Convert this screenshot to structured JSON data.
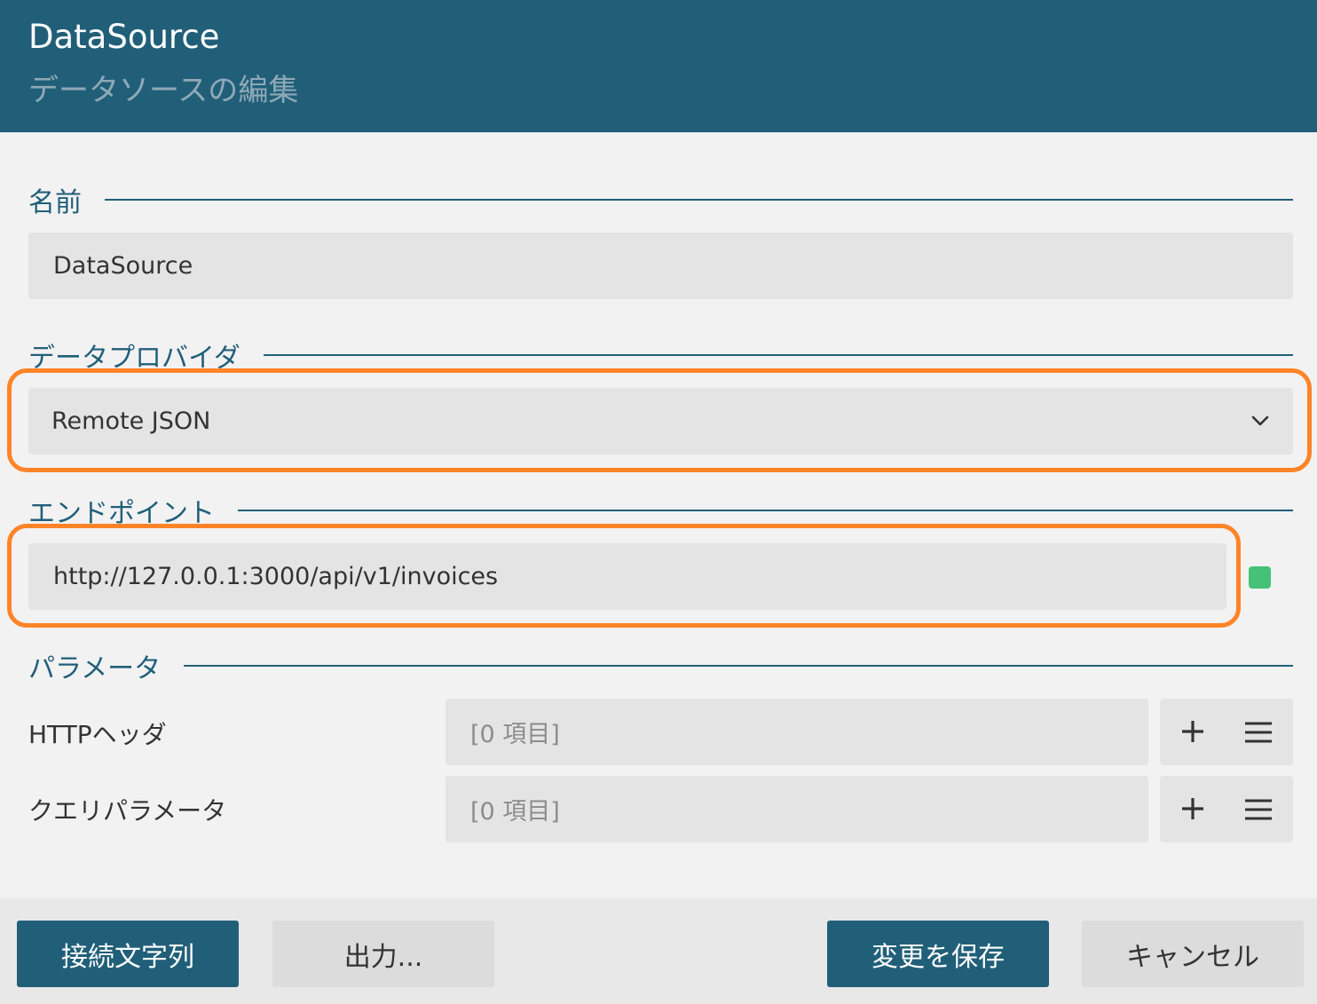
{
  "header": {
    "title": "DataSource",
    "subtitle": "データソースの編集"
  },
  "name_section": {
    "label": "名前",
    "value": "DataSource"
  },
  "provider_section": {
    "label": "データプロバイダ",
    "selected": "Remote JSON"
  },
  "endpoint_section": {
    "label": "エンドポイント",
    "value": "http://127.0.0.1:3000/api/v1/invoices",
    "status_color": "#45c277"
  },
  "params_section": {
    "label": "パラメータ",
    "rows": [
      {
        "label": "HTTPヘッダ",
        "value": "[0 項目]"
      },
      {
        "label": "クエリパラメータ",
        "value": "[0 項目]"
      }
    ]
  },
  "footer": {
    "connection_string_label": "接続文字列",
    "export_label": "出力...",
    "save_label": "変更を保存",
    "cancel_label": "キャンセル"
  },
  "colors": {
    "primary": "#215f79",
    "highlight": "#ff8428"
  }
}
